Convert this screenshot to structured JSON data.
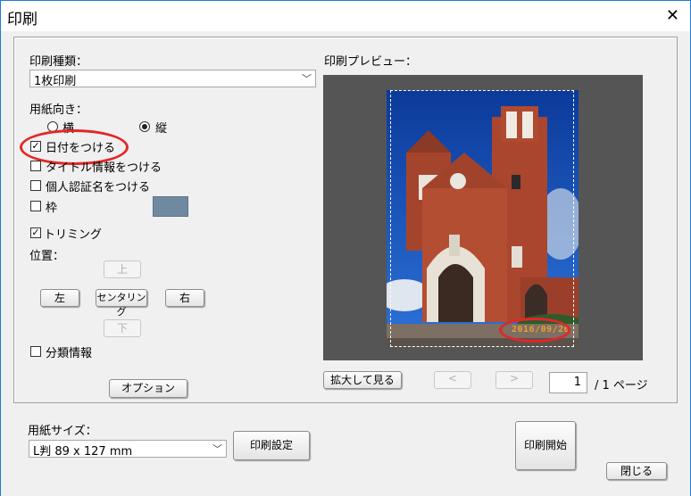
{
  "window": {
    "title": "印刷",
    "close_glyph": "✕"
  },
  "print_type": {
    "label": "印刷種類：",
    "selected": "1枚印刷"
  },
  "orientation": {
    "label": "用紙向き：",
    "landscape": "横",
    "portrait": "縦",
    "selected": "portrait"
  },
  "options": {
    "date": "日付をつける",
    "title_info": "タイトル情報をつける",
    "personal_name": "個人認証名をつける",
    "frame": "枠",
    "trimming": "トリミング",
    "frame_color": "#6f8aa0"
  },
  "position": {
    "label": "位置：",
    "up": "上",
    "left": "左",
    "center": "センタリング",
    "right": "右",
    "down": "下"
  },
  "category_info": "分類情報",
  "option_button": "オプション",
  "preview": {
    "label": "印刷プレビュー：",
    "zoom_button": "拡大して見る",
    "prev_glyph": "<",
    "next_glyph": ">",
    "page_current": "1",
    "page_total": "/ 1 ページ",
    "date_stamp": "2016/09/26"
  },
  "paper_size": {
    "label": "用紙サイズ：",
    "selected": "L判 89 x 127 mm"
  },
  "print_settings_button": "印刷設定",
  "start_print_button": "印刷開始",
  "close_button": "閉じる"
}
